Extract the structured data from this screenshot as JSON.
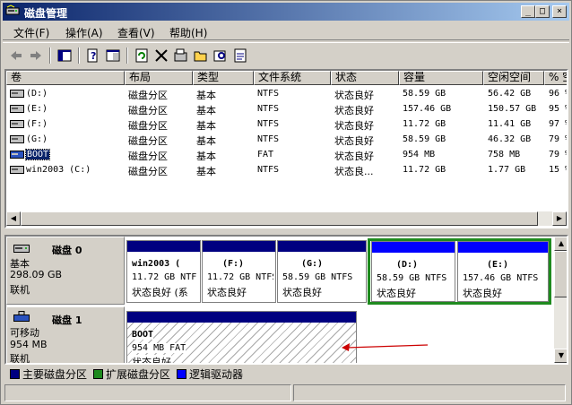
{
  "window": {
    "title": "磁盘管理",
    "min_glyph": "_",
    "max_glyph": "□",
    "close_glyph": "×"
  },
  "colors": {
    "title_start": "#0a246a",
    "title_end": "#a6caf0",
    "primary_partition": "#000080",
    "extended_partition": "#1e8a1e",
    "logical_drive": "#0000ff",
    "arrow": "#cc0000"
  },
  "menu": [
    {
      "label": "文件(F)"
    },
    {
      "label": "操作(A)"
    },
    {
      "label": "查看(V)"
    },
    {
      "label": "帮助(H)"
    }
  ],
  "toolbar_icons": [
    "back-arrow-icon",
    "forward-arrow-icon",
    "show-hide-tree-icon",
    "properties-icon",
    "help-icon",
    "refresh-icon",
    "delete-icon",
    "new-volume-icon",
    "open-folder-icon",
    "explore-icon",
    "format-icon"
  ],
  "columns": [
    "卷",
    "布局",
    "类型",
    "文件系统",
    "状态",
    "容量",
    "空闲空间",
    "% 空"
  ],
  "volumes": [
    {
      "name": " (D:)",
      "layout": "磁盘分区",
      "type": "基本",
      "fs": "NTFS",
      "status": "状态良好",
      "capacity": "58.59 GB",
      "free": "56.42 GB",
      "pct": "96 %"
    },
    {
      "name": " (E:)",
      "layout": "磁盘分区",
      "type": "基本",
      "fs": "NTFS",
      "status": "状态良好",
      "capacity": "157.46 GB",
      "free": "150.57 GB",
      "pct": "95 %"
    },
    {
      "name": " (F:)",
      "layout": "磁盘分区",
      "type": "基本",
      "fs": "NTFS",
      "status": "状态良好",
      "capacity": "11.72 GB",
      "free": "11.41 GB",
      "pct": "97 %"
    },
    {
      "name": " (G:)",
      "layout": "磁盘分区",
      "type": "基本",
      "fs": "NTFS",
      "status": "状态良好",
      "capacity": "58.59 GB",
      "free": "46.32 GB",
      "pct": "79 %"
    },
    {
      "name": "BOOT",
      "layout": "磁盘分区",
      "type": "基本",
      "fs": "FAT",
      "status": "状态良好",
      "capacity": "954 MB",
      "free": "758 MB",
      "pct": "79 %"
    },
    {
      "name": "win2003 (C:)",
      "layout": "磁盘分区",
      "type": "基本",
      "fs": "NTFS",
      "status": "状态良...",
      "capacity": "11.72 GB",
      "free": "1.77 GB",
      "pct": "15 %"
    }
  ],
  "disks": [
    {
      "title": "磁盘 0",
      "kind": "基本",
      "size": "298.09 GB",
      "state": "联机",
      "partitions": [
        {
          "name": "win2003  (",
          "detail": "11.72 GB NTF",
          "status": "状态良好 (系"
        },
        {
          "name": "(F:)",
          "detail": "11.72 GB NTFS",
          "status": "状态良好"
        },
        {
          "name": "(G:)",
          "detail": "58.59 GB NTFS",
          "status": "状态良好"
        },
        {
          "name": "(D:)",
          "detail": "58.59 GB NTFS",
          "status": "状态良好"
        },
        {
          "name": "(E:)",
          "detail": "157.46 GB NTFS",
          "status": "状态良好"
        }
      ]
    },
    {
      "title": "磁盘 1",
      "kind": "可移动",
      "size": "954 MB",
      "state": "联机",
      "partitions": [
        {
          "name": "BOOT",
          "detail": "954 MB FAT",
          "status": "状态良好"
        }
      ]
    }
  ],
  "legend": [
    {
      "label": "主要磁盘分区",
      "color": "#000080"
    },
    {
      "label": "扩展磁盘分区",
      "color": "#1e8a1e"
    },
    {
      "label": "逻辑驱动器",
      "color": "#0000ff"
    }
  ]
}
